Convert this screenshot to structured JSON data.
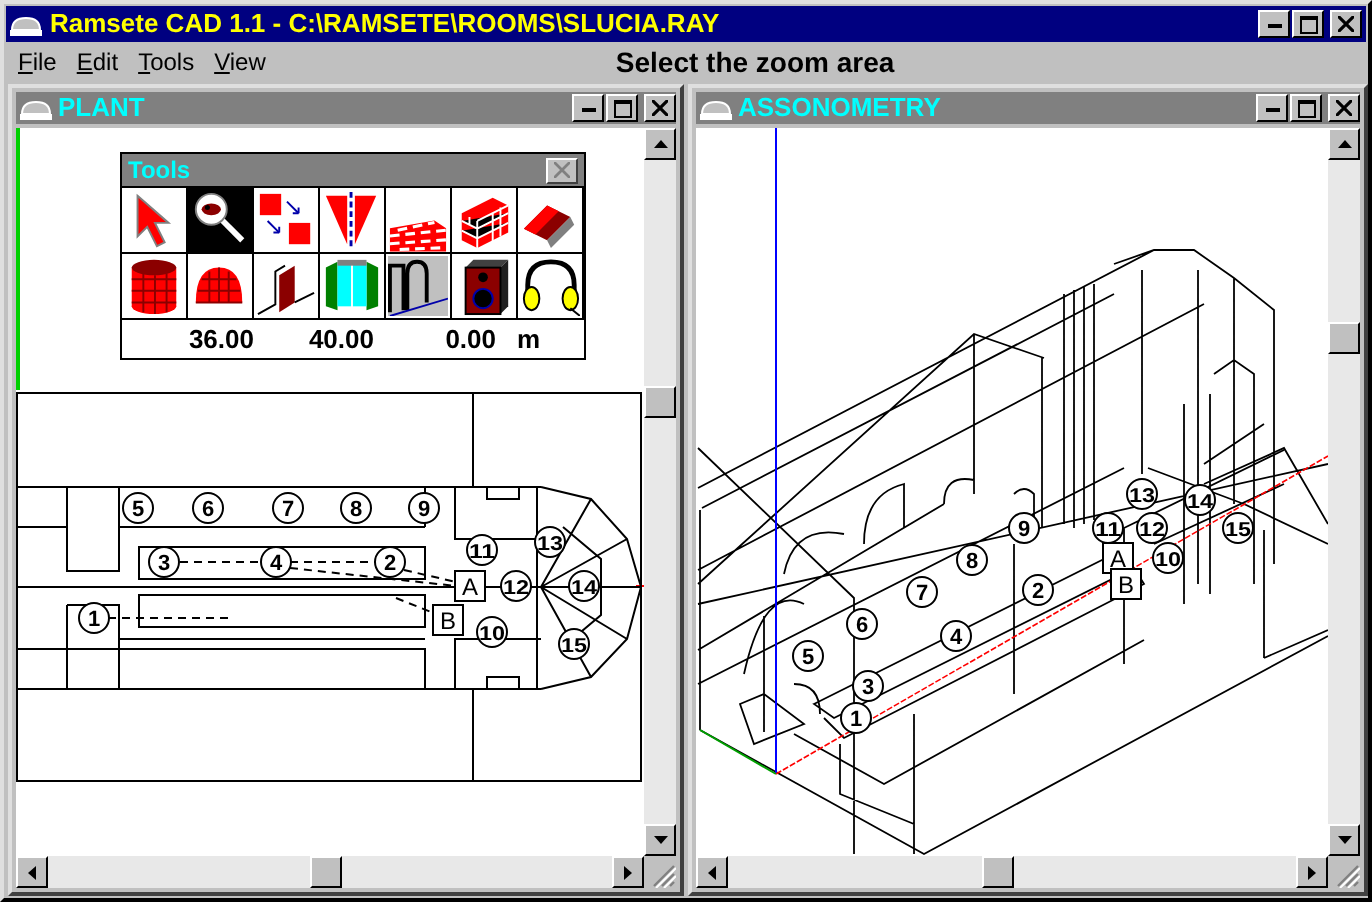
{
  "window": {
    "title": "Ramsete CAD 1.1 - C:\\RAMSETE\\ROOMS\\SLUCIA.RAY"
  },
  "menu": [
    "File",
    "Edit",
    "Tools",
    "View"
  ],
  "status": "Select the zoom area",
  "plant": {
    "title": "PLANT",
    "tools": {
      "title": "Tools",
      "items": [
        {
          "kind": "pointer",
          "selected": false
        },
        {
          "kind": "zoom",
          "selected": true
        },
        {
          "kind": "move",
          "selected": false
        },
        {
          "kind": "mirror",
          "selected": false
        },
        {
          "kind": "surface",
          "selected": false
        },
        {
          "kind": "wall",
          "selected": false
        },
        {
          "kind": "roof",
          "selected": false
        },
        {
          "kind": "cylinder",
          "selected": false
        },
        {
          "kind": "dome",
          "selected": false
        },
        {
          "kind": "panel",
          "selected": false
        },
        {
          "kind": "window",
          "selected": false
        },
        {
          "kind": "arch",
          "selected": false
        },
        {
          "kind": "speaker",
          "selected": false
        },
        {
          "kind": "listener",
          "selected": false
        }
      ],
      "readouts": [
        "36.00",
        "40.00",
        "0.00",
        "m"
      ]
    },
    "markers": [
      {
        "kind": "receiver",
        "label": "5"
      },
      {
        "kind": "receiver",
        "label": "6"
      },
      {
        "kind": "receiver",
        "label": "7"
      },
      {
        "kind": "receiver",
        "label": "8"
      },
      {
        "kind": "receiver",
        "label": "9"
      },
      {
        "kind": "receiver",
        "label": "3"
      },
      {
        "kind": "receiver",
        "label": "4"
      },
      {
        "kind": "receiver",
        "label": "2"
      },
      {
        "kind": "receiver",
        "label": "11"
      },
      {
        "kind": "receiver",
        "label": "13"
      },
      {
        "kind": "source",
        "label": "A"
      },
      {
        "kind": "receiver",
        "label": "12"
      },
      {
        "kind": "receiver",
        "label": "14"
      },
      {
        "kind": "receiver",
        "label": "1"
      },
      {
        "kind": "source",
        "label": "B"
      },
      {
        "kind": "receiver",
        "label": "10"
      },
      {
        "kind": "receiver",
        "label": "15"
      }
    ]
  },
  "assonometry": {
    "title": "ASSONOMETRY",
    "markers": [
      {
        "kind": "receiver",
        "label": "13"
      },
      {
        "kind": "receiver",
        "label": "14"
      },
      {
        "kind": "receiver",
        "label": "9"
      },
      {
        "kind": "receiver",
        "label": "11"
      },
      {
        "kind": "receiver",
        "label": "12"
      },
      {
        "kind": "receiver",
        "label": "15"
      },
      {
        "kind": "receiver",
        "label": "8"
      },
      {
        "kind": "source",
        "label": "A"
      },
      {
        "kind": "receiver",
        "label": "10"
      },
      {
        "kind": "receiver",
        "label": "7"
      },
      {
        "kind": "receiver",
        "label": "2"
      },
      {
        "kind": "source",
        "label": "B"
      },
      {
        "kind": "receiver",
        "label": "6"
      },
      {
        "kind": "receiver",
        "label": "4"
      },
      {
        "kind": "receiver",
        "label": "5"
      },
      {
        "kind": "receiver",
        "label": "3"
      },
      {
        "kind": "receiver",
        "label": "1"
      }
    ]
  }
}
